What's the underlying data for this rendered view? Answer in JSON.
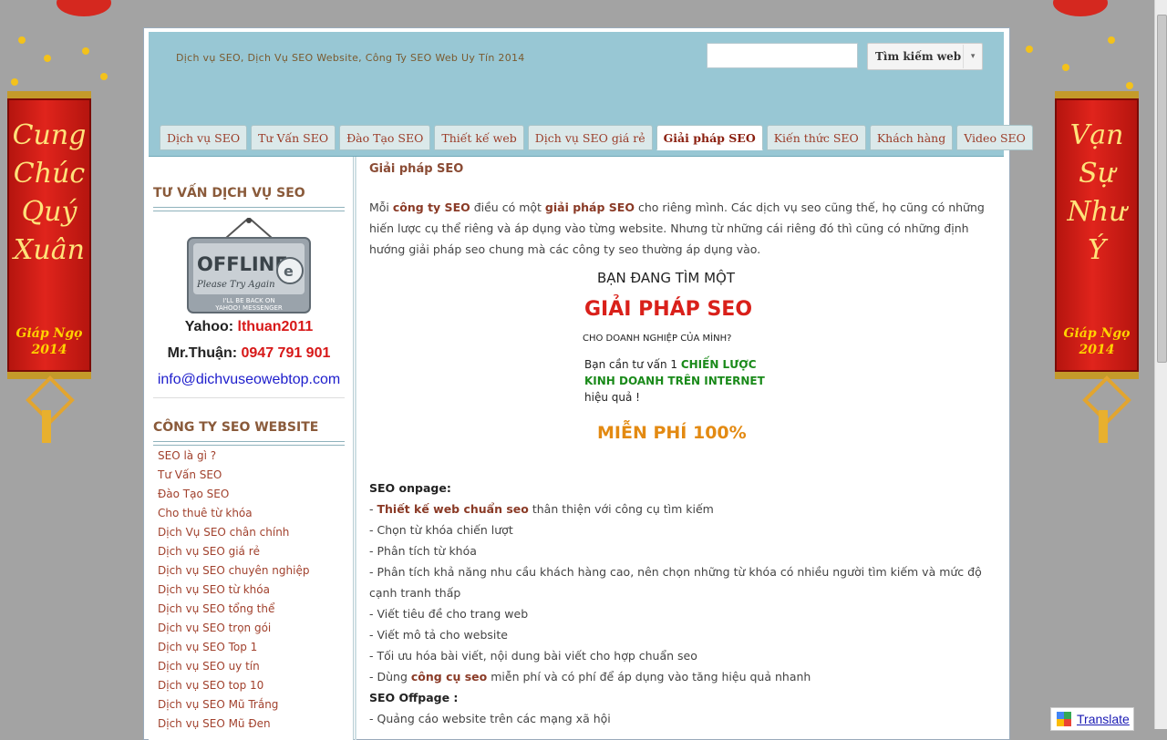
{
  "site": {
    "title": "Dịch vụ SEO, Dịch Vụ SEO Website, Công Ty SEO Web Uy Tín 2014"
  },
  "search": {
    "placeholder": "",
    "button": "Tìm kiếm web",
    "dropdown": "▾"
  },
  "nav": {
    "items": [
      "Dịch vụ SEO",
      "Tư Vấn SEO",
      "Đào Tạo SEO",
      "Thiết kế web",
      "Dịch vụ SEO giá rẻ",
      "Giải pháp SEO",
      "Kiến thức SEO",
      "Khách hàng",
      "Video SEO"
    ],
    "active": 5
  },
  "banners": {
    "left": {
      "text": "Cung\nChúc\nQuý\nXuân",
      "year": "Giáp Ngọ\n2014"
    },
    "right": {
      "text": "Vạn\nSự\nNhư\nÝ",
      "year": "Giáp Ngọ\n2014"
    }
  },
  "sidebar": {
    "widget1_title": "TƯ VẤN DỊCH VỤ SEO",
    "offline": {
      "line1": "OFFLINE",
      "line2": "Please Try Again",
      "line3": "I'LL BE BACK ON",
      "line4": "YAHOO! MESSENGER"
    },
    "yahoo_label": "Yahoo: ",
    "yahoo_value": "lthuan2011",
    "phone_label": "Mr.Thuận: ",
    "phone_value": "0947 791 901",
    "email": "info@dichvuseowebtop.com",
    "widget2_title": "CÔNG TY SEO WEBSITE",
    "links": [
      "SEO là gì ?",
      "Tư Vấn SEO",
      "Đào Tạo SEO",
      "Cho thuê từ khóa",
      "Dịch Vụ SEO chân chính",
      "Dịch vụ SEO giá rẻ",
      "Dịch vụ SEO chuyên nghiệp",
      "Dịch vụ SEO từ khóa",
      "Dịch vụ SEO tổng thể",
      "Dịch vụ SEO trọn gói",
      "Dịch vụ SEO Top 1",
      "Dịch vụ SEO uy tín",
      "Dịch vụ SEO top 10",
      "Dịch vụ SEO Mũ Trắng",
      "Dịch vụ SEO Mũ Đen"
    ]
  },
  "main": {
    "title": "Giải pháp SEO",
    "intro": {
      "p1": "Mỗi ",
      "b1": "công ty SEO",
      "p2": " điều có một ",
      "b2": "giải pháp SEO",
      "p3": " cho riêng mình. Các dịch vụ seo  cũng thế, họ cũng có những hiến lược cụ thể riêng và áp dụng vào từng website. Nhưng từ những cái riêng đó thì cũng có những định hướng giải pháp seo chung mà các công ty seo thường áp dụng vào."
    },
    "promo": {
      "l1": "BẠN ĐANG TÌM MỘT",
      "l2": "GIẢI PHÁP SEO",
      "l3": "CHO DOANH NGHIỆP CỦA MÌNH?",
      "l4a": "Bạn cần tư vấn 1 ",
      "l4b": "CHIẾN LƯỢC",
      "l5": "KINH DOANH TRÊN INTERNET",
      "l6": "hiệu quả !",
      "l7": "MIỄN PHÍ 100%"
    },
    "onpage_heading": "SEO onpage:",
    "onpage": [
      {
        "pre": "- ",
        "bold": "Thiết kế web chuẩn seo",
        "post": " thân thiện với công cụ tìm kiếm"
      },
      {
        "pre": "- Chọn từ khóa chiến lượt",
        "bold": "",
        "post": ""
      },
      {
        "pre": "- Phân tích từ khóa",
        "bold": "",
        "post": ""
      },
      {
        "pre": "- Phân tích khả năng nhu cầu khách hàng cao, nên chọn những từ khóa có nhiều người tìm kiếm và mức độ cạnh tranh thấp",
        "bold": "",
        "post": ""
      },
      {
        "pre": "- Viết tiêu đề cho trang web",
        "bold": "",
        "post": ""
      },
      {
        "pre": "- Viết mô tả cho website",
        "bold": "",
        "post": ""
      },
      {
        "pre": "- Tối ưu hóa bài viết, nội dung bài viết cho hợp chuẩn seo",
        "bold": "",
        "post": ""
      },
      {
        "pre": "- Dùng ",
        "bold": "công cụ seo",
        "post": " miễn phí và có phí để áp dụng vào tăng hiệu quả nhanh"
      }
    ],
    "offpage_heading": "SEO Offpage :",
    "offpage": [
      "- Quảng cáo website trên các mạng xã hội"
    ]
  },
  "translate": {
    "label": "Translate"
  }
}
